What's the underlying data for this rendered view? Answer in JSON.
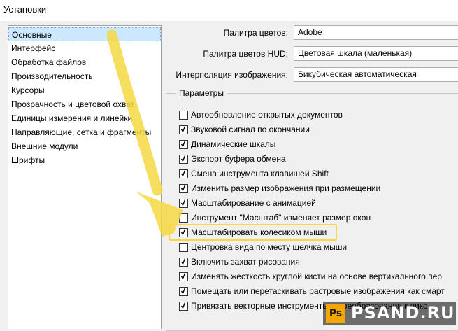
{
  "window": {
    "title": "Установки"
  },
  "sidebar": {
    "items": [
      {
        "label": "Основные",
        "selected": true
      },
      {
        "label": "Интерфейс"
      },
      {
        "label": "Обработка файлов"
      },
      {
        "label": "Производительность"
      },
      {
        "label": "Курсоры"
      },
      {
        "label": "Прозрачность и цветовой охват"
      },
      {
        "label": "Единицы измерения и линейки"
      },
      {
        "label": "Направляющие, сетка и фрагменты"
      },
      {
        "label": "Внешние модули"
      },
      {
        "label": "Шрифты"
      }
    ]
  },
  "settings": [
    {
      "label": "Палитра цветов:",
      "value": "Adobe"
    },
    {
      "label": "Палитра цветов HUD:",
      "value": "Цветовая шкала (маленькая)"
    },
    {
      "label": "Интерполяция изображения:",
      "value": "Бикубическая автоматическая"
    }
  ],
  "params": {
    "legend": "Параметры",
    "options": [
      {
        "label": "Автообновление открытых документов",
        "checked": false
      },
      {
        "label": "Звуковой сигнал по окончании",
        "checked": true
      },
      {
        "label": "Динамические шкалы",
        "checked": true
      },
      {
        "label": "Экспорт буфера обмена",
        "checked": true
      },
      {
        "label": "Смена инструмента клавишей Shift",
        "checked": true
      },
      {
        "label": "Изменить размер изображения при размещении",
        "checked": true
      },
      {
        "label": "Масштабирование с анимацией",
        "checked": true
      },
      {
        "label": "Инструмент \"Масштаб\" изменяет размер окон",
        "checked": false
      },
      {
        "label": "Масштабировать колесиком мыши",
        "checked": true,
        "highlighted": true
      },
      {
        "label": "Центровка вида по месту щелчка мыши",
        "checked": false
      },
      {
        "label": "Включить захват рисования",
        "checked": true
      },
      {
        "label": "Изменять жесткость круглой кисти на основе вертикального пер",
        "checked": true
      },
      {
        "label": "Помещать или перетаскивать растровые изображения как смарт",
        "checked": true
      },
      {
        "label": "Привязать векторные инструменты и преобразования к пикс",
        "checked": true
      }
    ]
  },
  "watermark": {
    "logo": "Ps",
    "text": "PSAND.RU"
  },
  "colors": {
    "annotation": "#f5d842",
    "selection": "#cce8ff",
    "watermark_logo": "#f2a800"
  }
}
